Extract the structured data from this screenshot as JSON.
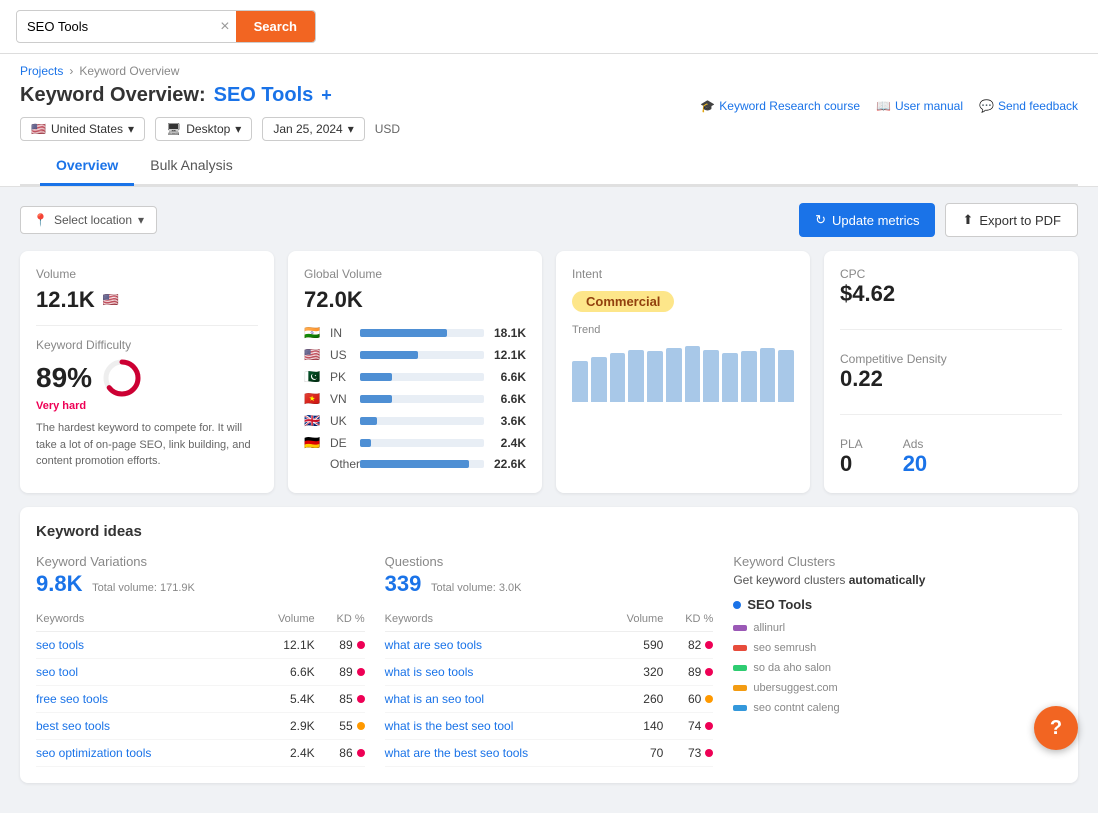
{
  "topbar": {
    "search_value": "SEO Tools",
    "search_placeholder": "Search",
    "search_btn_label": "Search",
    "clear_aria": "×"
  },
  "header": {
    "breadcrumb_projects": "Projects",
    "breadcrumb_sep": "›",
    "breadcrumb_current": "Keyword Overview",
    "title_prefix": "Keyword Overview:",
    "title_keyword": "SEO Tools",
    "title_plus": "+",
    "links": {
      "course": "Keyword Research course",
      "manual": "User manual",
      "feedback": "Send feedback"
    },
    "filters": {
      "country": "United States",
      "device": "Desktop",
      "date": "Jan 25, 2024",
      "currency": "USD"
    }
  },
  "tabs": [
    {
      "label": "Overview",
      "active": true
    },
    {
      "label": "Bulk Analysis",
      "active": false
    }
  ],
  "toolbar": {
    "location_placeholder": "Select location",
    "update_btn": "Update metrics",
    "export_btn": "Export to PDF"
  },
  "volume_card": {
    "label": "Volume",
    "value": "12.1K",
    "kd_label": "Keyword Difficulty",
    "kd_value": "89%",
    "kd_level": "Very hard",
    "kd_desc": "The hardest keyword to compete for. It will take a lot of on-page SEO, link building, and content promotion efforts."
  },
  "global_card": {
    "label": "Global Volume",
    "value": "72.0K",
    "countries": [
      {
        "flag": "🇮🇳",
        "code": "IN",
        "volume": "18.1K",
        "bar_pct": 70
      },
      {
        "flag": "🇺🇸",
        "code": "US",
        "volume": "12.1K",
        "bar_pct": 47
      },
      {
        "flag": "🇵🇰",
        "code": "PK",
        "volume": "6.6K",
        "bar_pct": 26
      },
      {
        "flag": "🇻🇳",
        "code": "VN",
        "volume": "6.6K",
        "bar_pct": 26
      },
      {
        "flag": "🇬🇧",
        "code": "UK",
        "volume": "3.6K",
        "bar_pct": 14
      },
      {
        "flag": "🇩🇪",
        "code": "DE",
        "volume": "2.4K",
        "bar_pct": 9
      },
      {
        "flag": "",
        "code": "Other",
        "volume": "22.6K",
        "bar_pct": 88
      }
    ]
  },
  "intent_card": {
    "label": "Intent",
    "badge": "Commercial",
    "trend_label": "Trend",
    "trend_bars": [
      55,
      60,
      65,
      70,
      68,
      72,
      75,
      70,
      65,
      68,
      72,
      70
    ]
  },
  "metrics_card": {
    "cpc_label": "CPC",
    "cpc_value": "$4.62",
    "comp_label": "Competitive Density",
    "comp_value": "0.22",
    "pla_label": "PLA",
    "pla_value": "0",
    "ads_label": "Ads",
    "ads_value": "20"
  },
  "keyword_ideas": {
    "title": "Keyword ideas",
    "variations": {
      "label": "Keyword Variations",
      "count": "9.8K",
      "total_label": "Total volume:",
      "total_value": "171.9K"
    },
    "questions": {
      "label": "Questions",
      "count": "339",
      "total_label": "Total volume:",
      "total_value": "3.0K"
    },
    "clusters": {
      "label": "Keyword Clusters",
      "auto_text": "Get keyword clusters",
      "auto_bold": "automatically",
      "item_title": "SEO Tools",
      "rows": [
        {
          "color": "#9b59b6",
          "text": "allinurl"
        },
        {
          "color": "#e74c3c",
          "text": "seo semrush"
        },
        {
          "color": "#2ecc71",
          "text": "so da aho salon"
        },
        {
          "color": "#f39c12",
          "text": "ubersuggest.com"
        },
        {
          "color": "#3498db",
          "text": "seo contnt caleng"
        }
      ]
    },
    "var_table": {
      "cols": [
        "Keywords",
        "Volume",
        "KD %"
      ],
      "rows": [
        {
          "kw": "seo tools",
          "vol": "12.1K",
          "kd": 89,
          "dot": "red"
        },
        {
          "kw": "seo tool",
          "vol": "6.6K",
          "kd": 89,
          "dot": "red"
        },
        {
          "kw": "free seo tools",
          "vol": "5.4K",
          "kd": 85,
          "dot": "red"
        },
        {
          "kw": "best seo tools",
          "vol": "2.9K",
          "kd": 55,
          "dot": "orange"
        },
        {
          "kw": "seo optimization tools",
          "vol": "2.4K",
          "kd": 86,
          "dot": "red"
        }
      ]
    },
    "q_table": {
      "cols": [
        "Keywords",
        "Volume",
        "KD %"
      ],
      "rows": [
        {
          "kw": "what are seo tools",
          "vol": "590",
          "kd": 82,
          "dot": "red"
        },
        {
          "kw": "what is seo tools",
          "vol": "320",
          "kd": 89,
          "dot": "red"
        },
        {
          "kw": "what is an seo tool",
          "vol": "260",
          "kd": 60,
          "dot": "orange"
        },
        {
          "kw": "what is the best seo tool",
          "vol": "140",
          "kd": 74,
          "dot": "red"
        },
        {
          "kw": "what are the best seo tools",
          "vol": "70",
          "kd": 73,
          "dot": "red"
        }
      ]
    }
  }
}
